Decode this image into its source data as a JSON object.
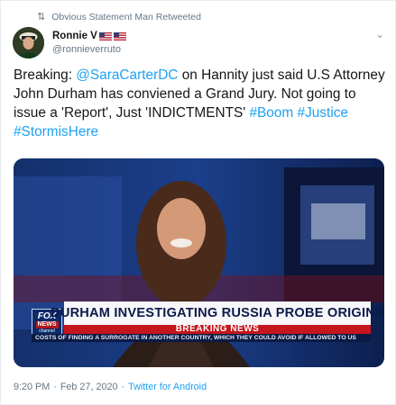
{
  "retweet": {
    "label": "Obvious Statement Man Retweeted"
  },
  "user": {
    "display_name": "Ronnie V",
    "handle": "@ronnieverruto"
  },
  "tweet": {
    "parts": [
      {
        "type": "text",
        "value": "Breaking: "
      },
      {
        "type": "mention",
        "value": "@SaraCarterDC"
      },
      {
        "type": "text",
        "value": " on Hannity just said U.S Attorney John Durham has conviened a Grand Jury. Not going to issue a 'Report', Just 'INDICTMENTS' "
      },
      {
        "type": "hashtag",
        "value": "#Boom"
      },
      {
        "type": "text",
        "value": " "
      },
      {
        "type": "hashtag",
        "value": "#Justice"
      },
      {
        "type": "text",
        "value": " "
      },
      {
        "type": "hashtag",
        "value": "#StormisHere"
      }
    ]
  },
  "media": {
    "headline": "DURHAM INVESTIGATING RUSSIA PROBE ORIGINS",
    "breaking": "BREAKING NEWS",
    "ticker": "COSTS OF FINDING A SURROGATE IN ANOTHER COUNTRY, WHICH THEY COULD AVOID IF ALLOWED TO US",
    "logo_top": "FOX",
    "logo_mid": "NEWS",
    "logo_bottom": "channel"
  },
  "meta": {
    "time": "9:20 PM",
    "separator": "·",
    "date": "Feb 27, 2020",
    "separator2": "·",
    "source": "Twitter for Android"
  },
  "colors": {
    "link": "#1da1f2",
    "muted": "#657786",
    "breaking_red": "#c4161c",
    "fox_navy": "#0a1a45"
  },
  "icons": {
    "retweet": "retweet-icon",
    "more": "chevron-down-icon"
  }
}
